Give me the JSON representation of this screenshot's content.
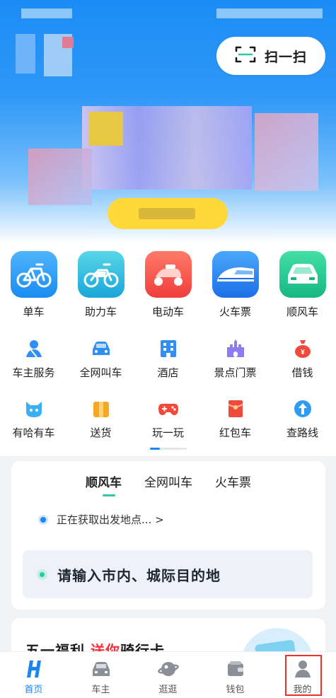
{
  "header": {
    "scan_label": "扫一扫"
  },
  "big_services": [
    {
      "label": "单车",
      "icon": "bicycle-icon"
    },
    {
      "label": "助力车",
      "icon": "ebike-icon"
    },
    {
      "label": "电动车",
      "icon": "scooter-icon"
    },
    {
      "label": "火车票",
      "icon": "train-icon"
    },
    {
      "label": "顺风车",
      "icon": "car-icon"
    }
  ],
  "small_services": [
    {
      "label": "车主服务",
      "icon": "driver-icon"
    },
    {
      "label": "全网叫车",
      "icon": "taxi-icon"
    },
    {
      "label": "酒店",
      "icon": "hotel-icon"
    },
    {
      "label": "景点门票",
      "icon": "castle-icon"
    },
    {
      "label": "借钱",
      "icon": "money-bag-icon"
    },
    {
      "label": "有哈有车",
      "icon": "cat-icon"
    },
    {
      "label": "送货",
      "icon": "box-icon"
    },
    {
      "label": "玩一玩",
      "icon": "gamepad-icon"
    },
    {
      "label": "红包车",
      "icon": "red-envelope-icon"
    },
    {
      "label": "查路线",
      "icon": "route-icon"
    }
  ],
  "booking": {
    "tabs": [
      "顺风车",
      "全网叫车",
      "火车票"
    ],
    "active_tab": "顺风车",
    "location_text": "正在获取出发地点... >",
    "destination_placeholder": "请输入市内、城际目的地"
  },
  "promo": {
    "title_part1": "五一福利 ",
    "title_red": "送你",
    "title_part2": "骑行卡"
  },
  "tabbar": {
    "items": [
      {
        "label": "首页",
        "icon": "home-h-icon",
        "active": true
      },
      {
        "label": "车主",
        "icon": "car-front-icon",
        "active": false
      },
      {
        "label": "逛逛",
        "icon": "planet-icon",
        "active": false
      },
      {
        "label": "钱包",
        "icon": "wallet-icon",
        "active": false
      },
      {
        "label": "我的",
        "icon": "profile-icon",
        "active": false
      }
    ]
  },
  "colors": {
    "primary_blue": "#1a86f0",
    "accent_green": "#2fc8a5",
    "promo_red": "#f5323b",
    "highlight_red": "#e8322a"
  }
}
